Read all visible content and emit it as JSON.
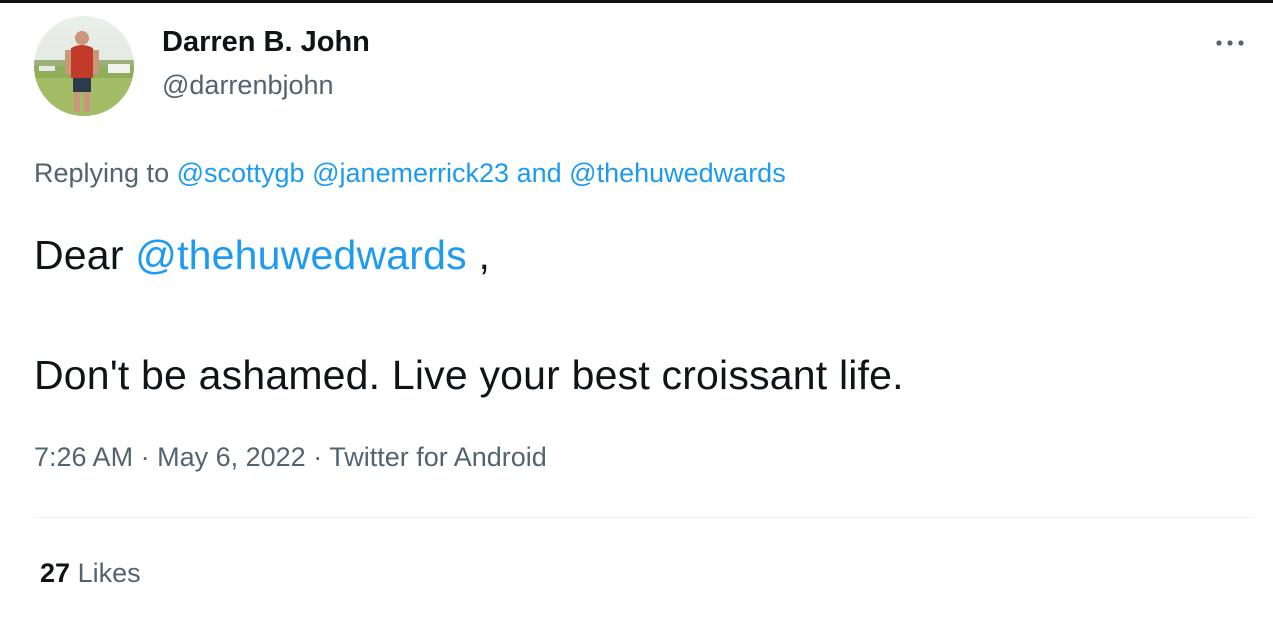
{
  "author": {
    "display_name": "Darren B. John",
    "handle": "@darrenbjohn",
    "avatar_icon": "profile-photo"
  },
  "menu": {
    "icon": "more-horizontal-icon"
  },
  "reply": {
    "prefix": "Replying to",
    "mention_1": "@scottygb",
    "mention_2": "@janemerrick23",
    "conjunction": "and",
    "mention_3": "@thehuwedwards"
  },
  "body": {
    "line1_prefix": "Dear",
    "line1_mention": "@thehuwedwards",
    "line1_suffix": " ,",
    "line2": "Don't be ashamed. Live your best croissant life."
  },
  "meta": {
    "time": "7:26 AM",
    "date": "May 6, 2022",
    "source": "Twitter for Android",
    "separator": "·"
  },
  "stats": {
    "likes_count": "27",
    "likes_label": "Likes"
  },
  "colors": {
    "text_primary": "#0f1419",
    "text_secondary": "#536471",
    "link": "#1d9bf0",
    "divider": "#eff3f4"
  }
}
